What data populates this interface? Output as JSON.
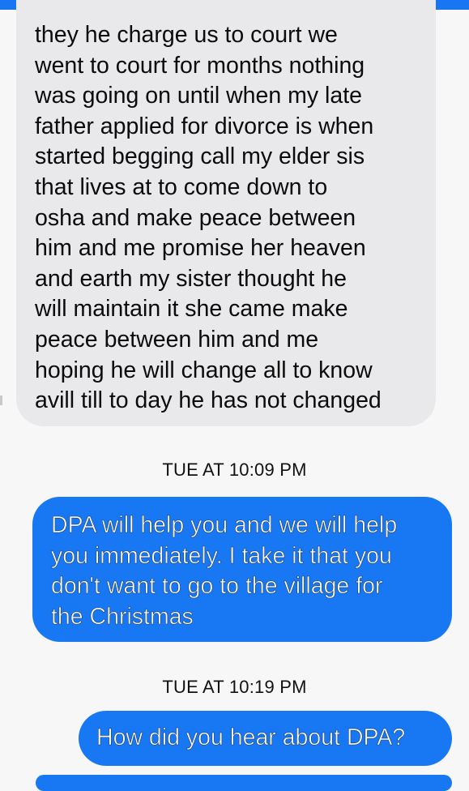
{
  "conversation": {
    "incoming_message": {
      "lines": [
        "they he charge us to court we",
        "went to court for months nothing",
        "was going on until when my late",
        "father applied for divorce is when",
        "started begging call my elder sis",
        "that lives at to come down to",
        "osha and make peace between",
        "him and me promise her heaven",
        "and earth my sister thought he",
        "will maintain it she came make",
        "peace between him and me",
        "hoping he will change all to know",
        "avill till to day he has not changed"
      ]
    },
    "timestamps": [
      "TUE AT 10:09 PM",
      "TUE AT 10:19 PM"
    ],
    "outgoing_messages": [
      {
        "lines": [
          "DPA will help you and we will help",
          "you immediately. I take it that you",
          "don't want to go to the village for",
          "the Christmas"
        ]
      },
      {
        "text": "How did you hear about DPA?"
      }
    ]
  },
  "colors": {
    "outgoing_bubble": "#1877f2",
    "incoming_bubble": "#e9e9eb",
    "background": "#f7f7f7",
    "top_bar": "#1976f2"
  }
}
